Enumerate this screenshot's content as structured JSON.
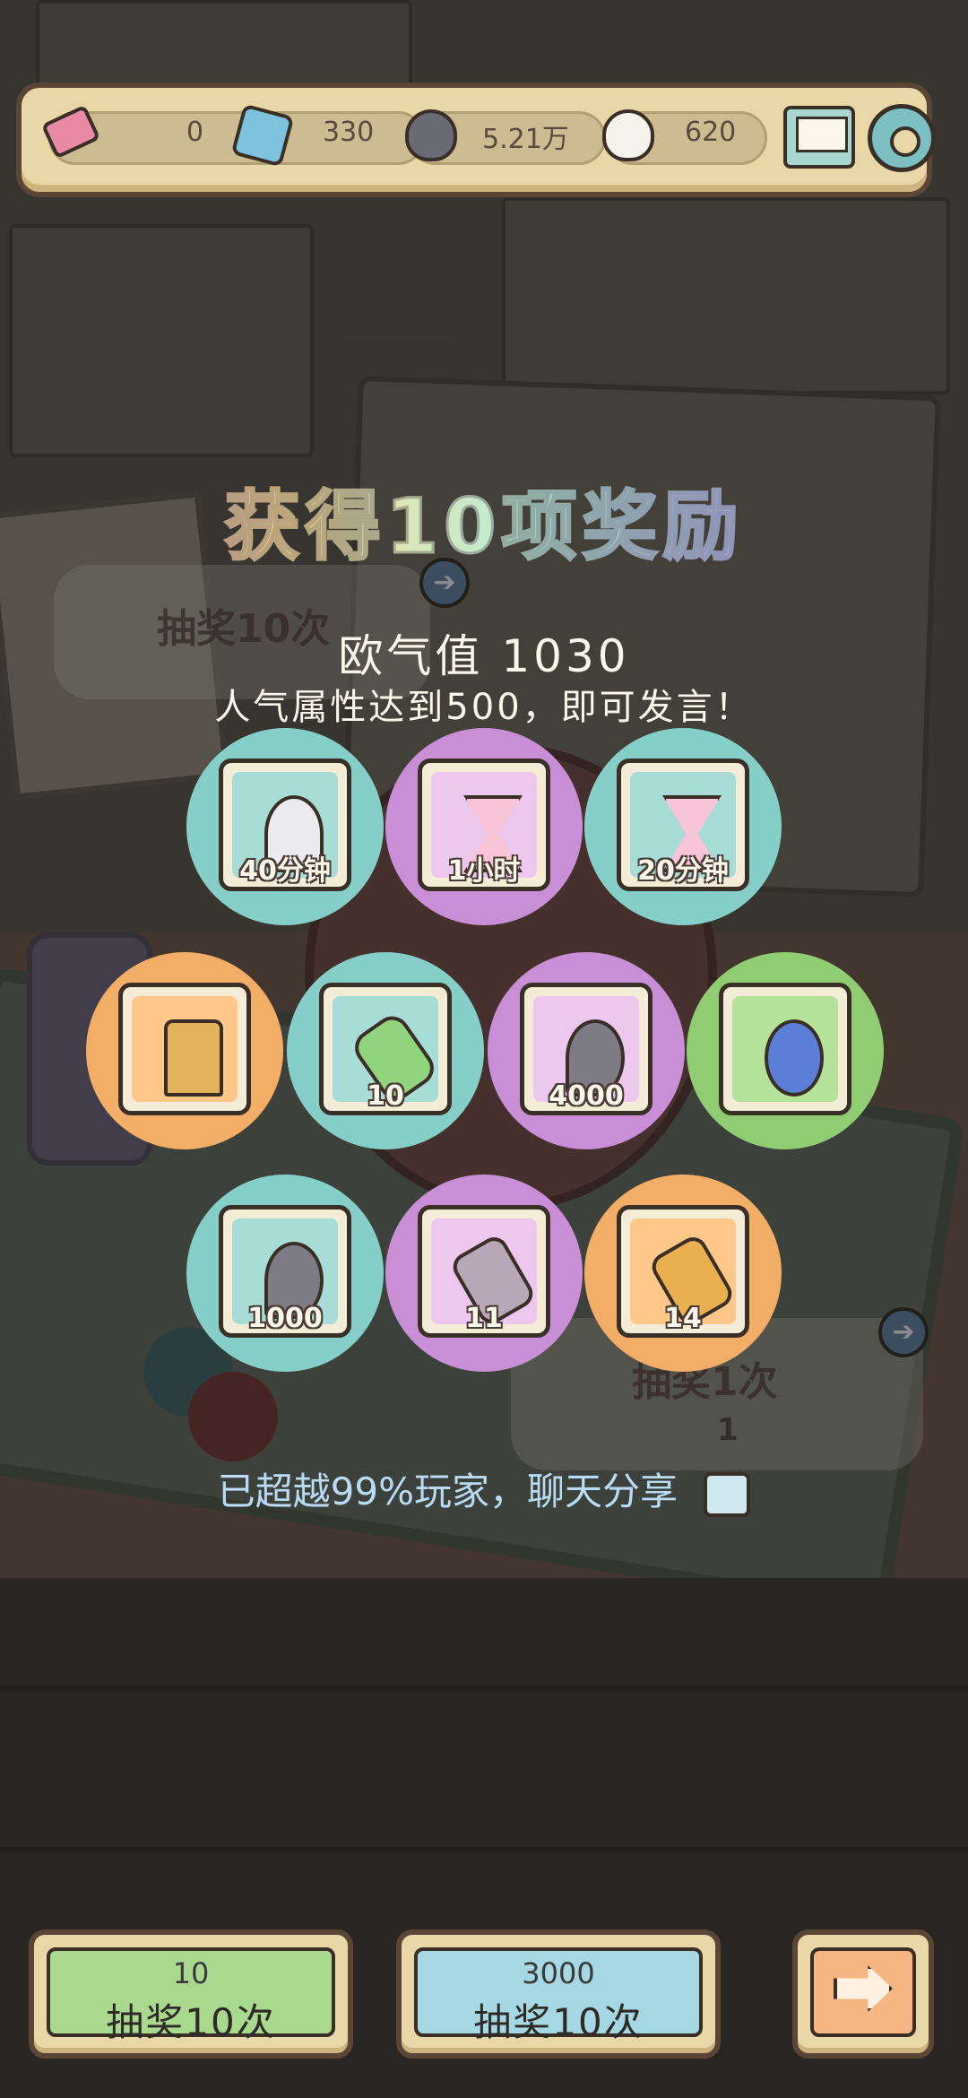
{
  "resources": {
    "ticket": "0",
    "cube": "330",
    "dark_ghost": "5.21万",
    "light_ghost": "620"
  },
  "reward_screen": {
    "title": "获得10项奖励",
    "luck": "欧气值 1030",
    "hint": "人气属性达到500，即可发言！",
    "share": "已超越99%玩家，聊天分享",
    "rewards": [
      {
        "item": "ghost-costume",
        "amount": "40分钟",
        "color": "#86cfc8"
      },
      {
        "item": "hourglass",
        "amount": "1小时",
        "color": "#c88fd6"
      },
      {
        "item": "hourglass",
        "amount": "20分钟",
        "color": "#86cfc8"
      },
      {
        "item": "trophy",
        "amount": "",
        "color": "#f2ad66"
      },
      {
        "item": "test-tube",
        "amount": "10",
        "color": "#86cfc8"
      },
      {
        "item": "ghost-drop",
        "amount": "4000",
        "color": "#c88fd6"
      },
      {
        "item": "flower-ring",
        "amount": "",
        "color": "#8fcc72"
      },
      {
        "item": "ghost-drop",
        "amount": "1000",
        "color": "#86cfc8"
      },
      {
        "item": "cannon",
        "amount": "11",
        "color": "#c88fd6"
      },
      {
        "item": "gold-cannon",
        "amount": "14",
        "color": "#f2ad66"
      }
    ]
  },
  "background": {
    "draw10_label": "抽奖10次",
    "draw1_label": "抽奖1次",
    "draw1_cost": "1"
  },
  "buttons": {
    "draw_ticket": {
      "cost": "10",
      "label": "抽奖10次"
    },
    "draw_ghost": {
      "cost": "3000",
      "label": "抽奖10次"
    }
  }
}
